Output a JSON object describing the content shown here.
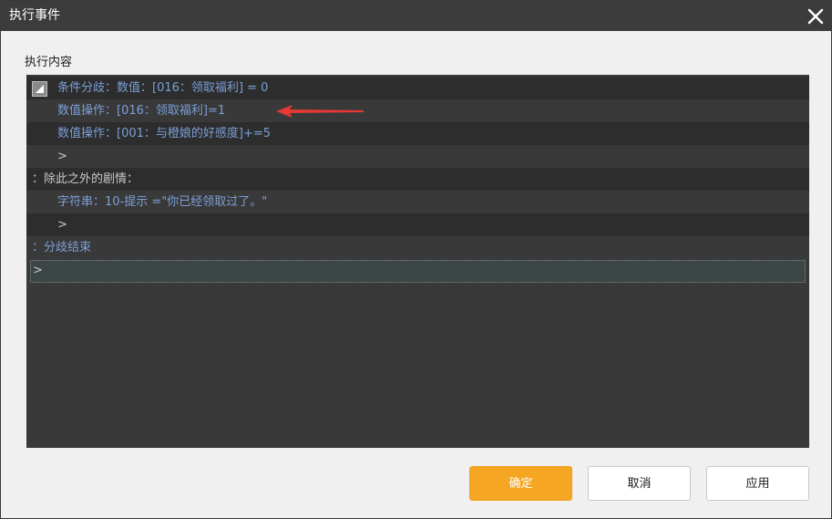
{
  "window": {
    "title": "执行事件",
    "close_icon": "close-icon"
  },
  "content": {
    "section_label": "执行内容",
    "rows": [
      {
        "text": "条件分歧：数值：[016：领取福利] = 0",
        "color": "#7b9fd6",
        "collapse_icon": "collapse-icon"
      },
      {
        "text": "数值操作：[016：领取福利]=1",
        "color": "#7b9fd6"
      },
      {
        "text": "数值操作：[001：与橙娘的好感度]+=5",
        "color": "#7b9fd6"
      },
      {
        "text": ">",
        "color": "#c8c8c8"
      },
      {
        "text": "：除此之外的剧情：",
        "color": "#c8c8c8"
      },
      {
        "text": "字符串：10-提示 =\"你已经领取过了。\"",
        "color": "#7b9fd6"
      },
      {
        "text": ">",
        "color": "#c8c8c8"
      },
      {
        "text": "：分歧结束",
        "color": "#7b9fd6"
      },
      {
        "text": ">",
        "color": "#c8c8c8"
      }
    ],
    "annotation": {
      "arrow_color": "#e53935"
    }
  },
  "buttons": {
    "confirm_label": "确定",
    "cancel_label": "取消",
    "apply_label": "应用",
    "accent_color": "#f5a623"
  }
}
